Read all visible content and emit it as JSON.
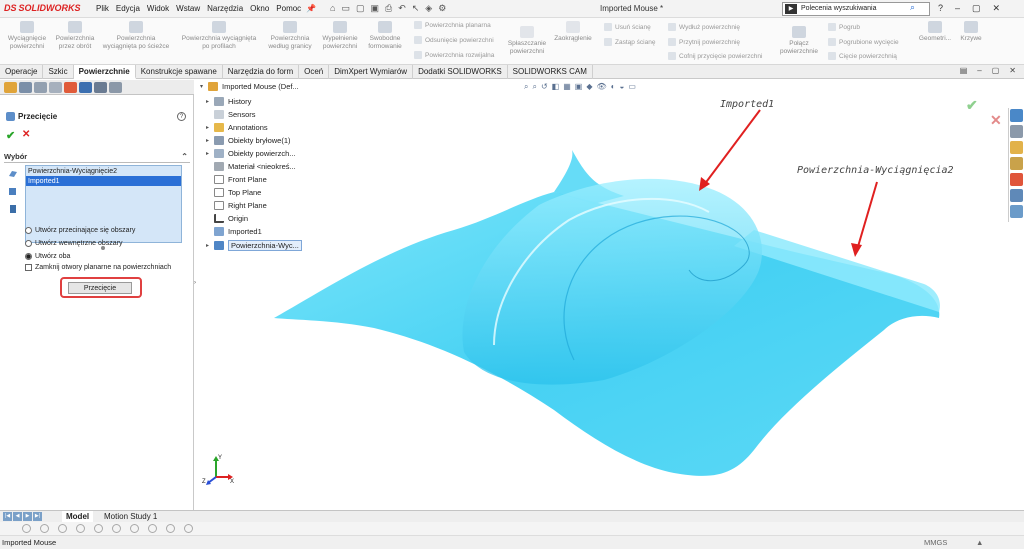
{
  "app": {
    "logo_text": "SOLIDWORKS",
    "logo_mark": "DS",
    "document_title": "Imported Mouse *"
  },
  "menu": [
    "Plik",
    "Edycja",
    "Widok",
    "Wstaw",
    "Narzędzia",
    "Okno",
    "Pomoc"
  ],
  "search": {
    "placeholder": "Polecenia wyszukiwania"
  },
  "ribbon": {
    "tools": [
      {
        "label1": "Wyciągnięcie",
        "label2": "powierzchni"
      },
      {
        "label1": "Powierzchnia",
        "label2": "przez obrót"
      },
      {
        "label1": "Powierzchnia",
        "label2": "wyciągnięta po ścieżce"
      },
      {
        "label1": "Powierzchnia wyciągnięta",
        "label2": "po profilach"
      },
      {
        "label1": "Powierzchnia",
        "label2": "według granicy"
      },
      {
        "label1": "Wypełnienie",
        "label2": "powierzchni"
      },
      {
        "label1": "Swobodne",
        "label2": "formowanie"
      }
    ],
    "group2": [
      "Powierzchnia planarna",
      "Odsunięcie powierzchni",
      "Powierzchnia rozwijalna"
    ],
    "flatten": {
      "label1": "Spłaszczanie",
      "label2": "powierzchni"
    },
    "fillet": "Zaokrąglenie",
    "group3": [
      "Usuń ścianę",
      "Zastąp ścianę"
    ],
    "group4": [
      "Wydłuż powierzchnię",
      "Przytnij powierzchnię",
      "Cofnij przycięcie powierzchni"
    ],
    "knit": {
      "label1": "Połącz",
      "label2": "powierzchnie"
    },
    "group5": [
      "Pogrub",
      "Pogrubione wycięcie",
      "Cięcie powierzchnią"
    ],
    "geometry": "Geometri...",
    "curves": "Krzywe"
  },
  "tabs": [
    "Operacje",
    "Szkic",
    "Powierzchnie",
    "Konstrukcje spawane",
    "Narzędzia do form",
    "Oceń",
    "DimXpert Wymiarów",
    "Dodatki SOLIDWORKS",
    "SOLIDWORKS CAM"
  ],
  "property_manager": {
    "title": "Przecięcie",
    "help": "?",
    "section": "Wybór",
    "selections": [
      "Powierzchnia-Wyciągnięcie2",
      "Imported1"
    ],
    "options": [
      {
        "label": "Utwórz przecinające się obszary",
        "checked": false
      },
      {
        "label": "Utwórz wewnętrzne obszary",
        "checked": false
      },
      {
        "label": "Utwórz oba",
        "checked": true
      }
    ],
    "checkbox": "Zamknij otwory planarne na powierzchniach",
    "button": "Przecięcie"
  },
  "tree": {
    "root": "Imported Mouse  (Def...",
    "items": [
      "History",
      "Sensors",
      "Annotations",
      "Obiekty bryłowe(1)",
      "Obiekty powierzch...",
      "Materiał <nieokreś...",
      "Front Plane",
      "Top Plane",
      "Right Plane",
      "Origin",
      "Imported1",
      "Powierzchnia-Wyc..."
    ]
  },
  "callouts": {
    "imported": "Imported1",
    "extrude": "Powierzchnia-Wyciągnięcia2"
  },
  "triad": {
    "x": "X",
    "y": "Y",
    "z": "Z"
  },
  "bottom_tabs": [
    "Model",
    "Motion Study 1"
  ],
  "status": {
    "left": "Imported Mouse",
    "units": "MMGS",
    "units_arrow": "▲"
  },
  "colors": {
    "accent": "#2a6fd6",
    "surface": "#3fd2f5",
    "highlight_border": "#e04040"
  }
}
